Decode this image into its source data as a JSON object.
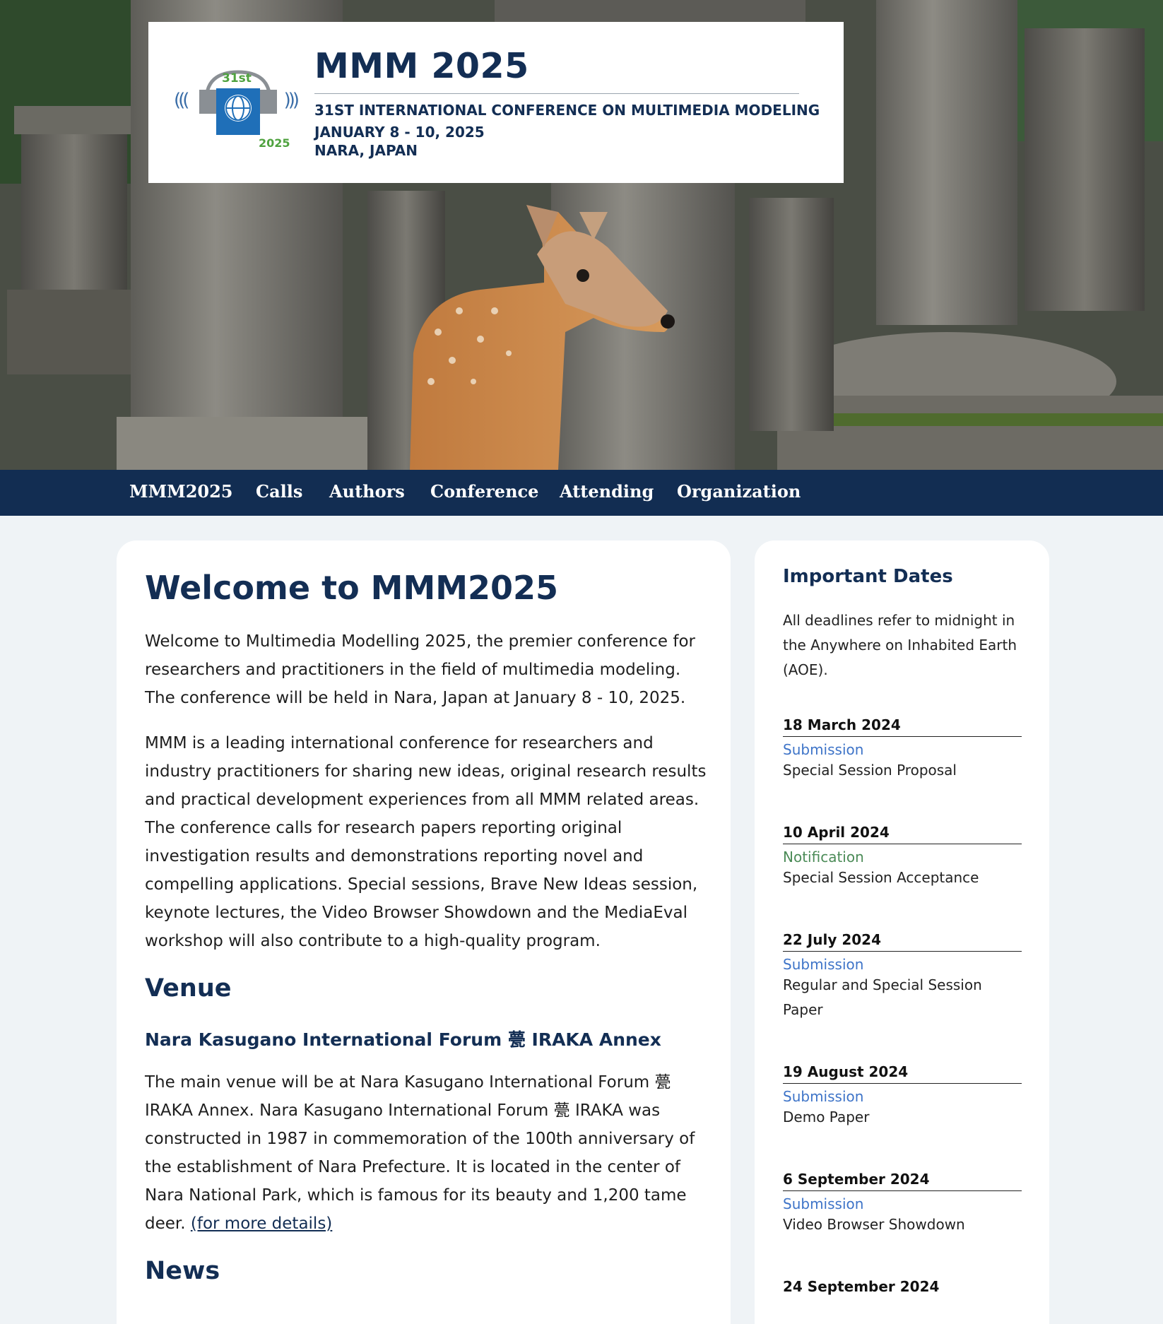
{
  "header": {
    "logo_ordinal": "31st",
    "logo_year": "2025",
    "title": "MMM 2025",
    "subtitle": "31ST INTERNATIONAL CONFERENCE ON MULTIMEDIA MODELING",
    "dates": "JANUARY 8 - 10, 2025",
    "location": "NARA, JAPAN"
  },
  "nav": {
    "items": [
      {
        "label": "MMM2025"
      },
      {
        "label": "Calls"
      },
      {
        "label": "Authors"
      },
      {
        "label": "Conference"
      },
      {
        "label": "Attending"
      },
      {
        "label": "Organization"
      }
    ]
  },
  "main": {
    "title": "Welcome to MMM2025",
    "intro": "Welcome to Multimedia Modelling 2025, the premier conference for researchers and practitioners in the field of multimedia modeling. The conference will be held in Nara, Japan at January 8 - 10, 2025.",
    "about": "MMM is a leading international conference for researchers and industry practitioners for sharing new ideas, original research results and practical development experiences from all MMM related areas. The conference calls for research papers reporting original investigation results and demonstrations reporting novel and compelling applications. Special sessions, Brave New Ideas session, keynote lectures, the Video Browser Showdown and the MediaEval workshop will also contribute to a high-quality program.",
    "venue_heading": "Venue",
    "venue_name": "Nara Kasugano International Forum 甍 IRAKA Annex",
    "venue_text": "The main venue will be at Nara Kasugano International Forum 甍 IRAKA Annex. Nara Kasugano International Forum 甍 IRAKA was constructed in 1987 in commemoration of the 100th anniversary of the establishment of Nara Prefecture. It is located in the center of Nara National Park, which is famous for its beauty and 1,200 tame deer.",
    "venue_link": "(for more details)",
    "news_heading": "News"
  },
  "sidebar": {
    "title": "Important Dates",
    "note": "All deadlines refer to midnight in the Anywhere on Inhabited Earth (AOE).",
    "dates": [
      {
        "date": "18 March 2024",
        "kind": "Submission",
        "desc": "Special Session Proposal"
      },
      {
        "date": "10 April 2024",
        "kind": "Notification",
        "desc": "Special Session Acceptance"
      },
      {
        "date": "22 July 2024",
        "kind": "Submission",
        "desc": "Regular and Special Session Paper"
      },
      {
        "date": "19 August 2024",
        "kind": "Submission",
        "desc": "Demo Paper"
      },
      {
        "date": "6 September 2024",
        "kind": "Submission",
        "desc": "Video Browser Showdown"
      },
      {
        "date": "24 September 2024",
        "kind": "",
        "desc": ""
      }
    ]
  },
  "colors": {
    "navy": "#132e54",
    "nav_bg": "#122d52",
    "page_bg": "#eff3f6",
    "submission": "#3e74c8",
    "notification": "#4b8b57",
    "logo_green": "#4fa23f"
  }
}
